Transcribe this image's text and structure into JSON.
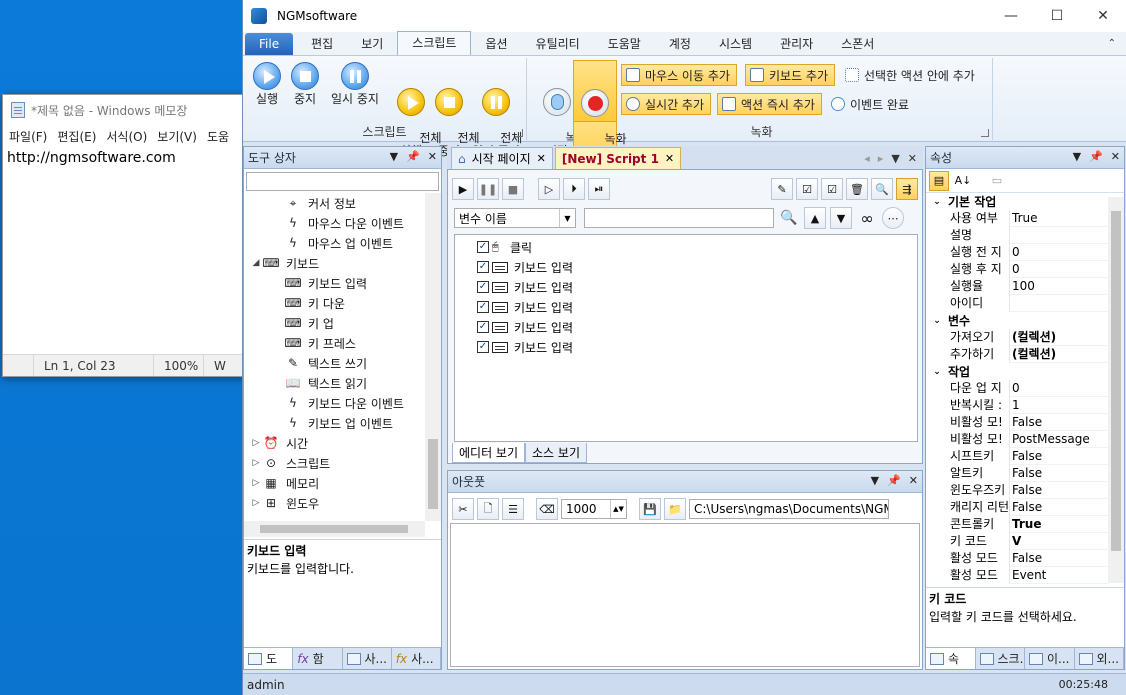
{
  "notepad": {
    "title": "*제목 없음 - Windows 메모장",
    "menu": [
      "파일(F)",
      "편집(E)",
      "서식(O)",
      "보기(V)",
      "도움"
    ],
    "content": "http://ngmsoftware.com",
    "status": {
      "pos": "Ln 1, Col 23",
      "zoom": "100%",
      "enc": "W"
    }
  },
  "app": {
    "title": "NGMsoftware",
    "window": {
      "minimize": "—",
      "maximize": "☐",
      "close": "✕"
    },
    "ribbon_tabs": [
      "File",
      "편집",
      "보기",
      "스크립트",
      "옵션",
      "유틸리티",
      "도움말",
      "계정",
      "시스템",
      "관리자",
      "스폰서"
    ],
    "active_tab": "스크립트",
    "ribbon": {
      "script_group": {
        "label": "스크립트",
        "buttons": [
          {
            "label": "실행",
            "icon": "play-icon"
          },
          {
            "label": "중지",
            "icon": "stop-icon"
          },
          {
            "label": "일시 중지",
            "icon": "pause-icon"
          },
          {
            "label": "전체\n실행",
            "icon": "play-all-icon"
          },
          {
            "label": "전체\n중지",
            "icon": "stop-all-icon"
          },
          {
            "label": "전체\n일시 중지",
            "icon": "pause-all-icon"
          }
        ]
      },
      "record_group": {
        "label": "녹화",
        "buttons": [
          {
            "label": "녹화\n시작",
            "icon": "record-start-icon"
          },
          {
            "label": "녹화\n중지",
            "icon": "record-stop-icon"
          }
        ],
        "small": [
          {
            "label": "마우스 이동 추가",
            "highlight": true
          },
          {
            "label": "키보드 추가",
            "highlight": true
          },
          {
            "label": "선택한 액션 안에 추가",
            "highlight": false
          },
          {
            "label": "실시간 추가",
            "highlight": true
          },
          {
            "label": "액션 즉시 추가",
            "highlight": true
          },
          {
            "label": "이벤트 완료",
            "highlight": false
          }
        ]
      }
    },
    "toolbox": {
      "title": "도구 상자",
      "items": [
        {
          "label": "커서 정보",
          "level": 2,
          "icon": "cursor-icon",
          "glyph": "⌖"
        },
        {
          "label": "마우스 다운 이벤트",
          "level": 2,
          "icon": "lightning-icon",
          "glyph": "ϟ"
        },
        {
          "label": "마우스 업 이벤트",
          "level": 2,
          "icon": "lightning-icon",
          "glyph": "ϟ"
        },
        {
          "label": "키보드",
          "level": 1,
          "icon": "keyboard-icon",
          "glyph": "⌨",
          "toggle": "◢"
        },
        {
          "label": "키보드 입력",
          "level": 2,
          "icon": "keyboard-icon",
          "glyph": "⌨"
        },
        {
          "label": "키 다운",
          "level": 2,
          "icon": "key-down-icon",
          "glyph": "⌨"
        },
        {
          "label": "키 업",
          "level": 2,
          "icon": "key-up-icon",
          "glyph": "⌨"
        },
        {
          "label": "키 프레스",
          "level": 2,
          "icon": "key-press-icon",
          "glyph": "⌨"
        },
        {
          "label": "텍스트 쓰기",
          "level": 2,
          "icon": "book-write-icon",
          "glyph": "✎"
        },
        {
          "label": "텍스트 읽기",
          "level": 2,
          "icon": "book-read-icon",
          "glyph": "📖"
        },
        {
          "label": "키보드 다운 이벤트",
          "level": 2,
          "icon": "lightning-icon",
          "glyph": "ϟ"
        },
        {
          "label": "키보드 업 이벤트",
          "level": 2,
          "icon": "lightning-icon",
          "glyph": "ϟ"
        },
        {
          "label": "시간",
          "level": 1,
          "icon": "clock-icon",
          "glyph": "⏰",
          "toggle": "▷"
        },
        {
          "label": "스크립트",
          "level": 1,
          "icon": "script-icon",
          "glyph": "⊙",
          "toggle": "▷"
        },
        {
          "label": "메모리",
          "level": 1,
          "icon": "memory-icon",
          "glyph": "▦",
          "toggle": "▷"
        },
        {
          "label": "윈도우",
          "level": 1,
          "icon": "windows-icon",
          "glyph": "⊞",
          "toggle": "▷"
        }
      ],
      "desc_title": "키보드 입력",
      "desc_text": "키보드를 입력합니다.",
      "bottom_tabs": [
        "도",
        "함",
        "사...",
        "사..."
      ]
    },
    "doc_tabs": [
      {
        "label": "시작 페이지",
        "active": false
      },
      {
        "label": "[New] Script 1",
        "active": true
      }
    ],
    "editor": {
      "variable_combo": "변수 이름",
      "search_value": "",
      "items": [
        {
          "label": "클릭",
          "icon": "mouse"
        },
        {
          "label": "키보드 입력",
          "icon": "kb"
        },
        {
          "label": "키보드 입력",
          "icon": "kb"
        },
        {
          "label": "키보드 입력",
          "icon": "kb"
        },
        {
          "label": "키보드 입력",
          "icon": "kb"
        },
        {
          "label": "키보드 입력",
          "icon": "kb"
        }
      ],
      "view_tabs": [
        "에디터 보기",
        "소스 보기"
      ]
    },
    "output": {
      "title": "아웃풋",
      "count": "1000",
      "path": "C:\\Users\\ngmas\\Documents\\NGM6\\"
    },
    "properties": {
      "title": "속성",
      "categories": [
        {
          "name": "기본 작업",
          "rows": [
            {
              "n": "사용 여부",
              "v": "True"
            },
            {
              "n": "설명",
              "v": ""
            },
            {
              "n": "실행 전 지",
              "v": "0"
            },
            {
              "n": "실행 후 지",
              "v": "0"
            },
            {
              "n": "실행율",
              "v": "100"
            },
            {
              "n": "아이디",
              "v": ""
            }
          ]
        },
        {
          "name": "변수",
          "rows": [
            {
              "n": "가져오기",
              "v": "(컬렉션)",
              "bv": true
            },
            {
              "n": "추가하기",
              "v": "(컬렉션)",
              "bv": true
            }
          ]
        },
        {
          "name": "작업",
          "rows": [
            {
              "n": "다운 업 지",
              "v": "0"
            },
            {
              "n": "반복시킬 :",
              "v": "1"
            },
            {
              "n": "비활성 모!",
              "v": "False"
            },
            {
              "n": "비활성 모!",
              "v": "PostMessage"
            },
            {
              "n": "시프트키",
              "v": "False"
            },
            {
              "n": "알트키",
              "v": "False"
            },
            {
              "n": "윈도우즈키",
              "v": "False"
            },
            {
              "n": "캐리지 리턴",
              "v": "False"
            },
            {
              "n": "콘트롤키",
              "v": "True",
              "bv": true
            },
            {
              "n": "키 코드",
              "v": "V",
              "bv": true
            },
            {
              "n": "활성 모드",
              "v": "False"
            },
            {
              "n": "활성 모드",
              "v": "Event"
            }
          ]
        }
      ],
      "desc_title": "키 코드",
      "desc_text": "입력할 키 코드를 선택하세요.",
      "bottom_tabs": [
        "속",
        "스크...",
        "이...",
        "외..."
      ]
    },
    "status": {
      "user": "admin",
      "time": "00:25:48"
    },
    "colors": {
      "accent": "#ffd25c",
      "ribbon_blue": "#2563b8"
    }
  }
}
